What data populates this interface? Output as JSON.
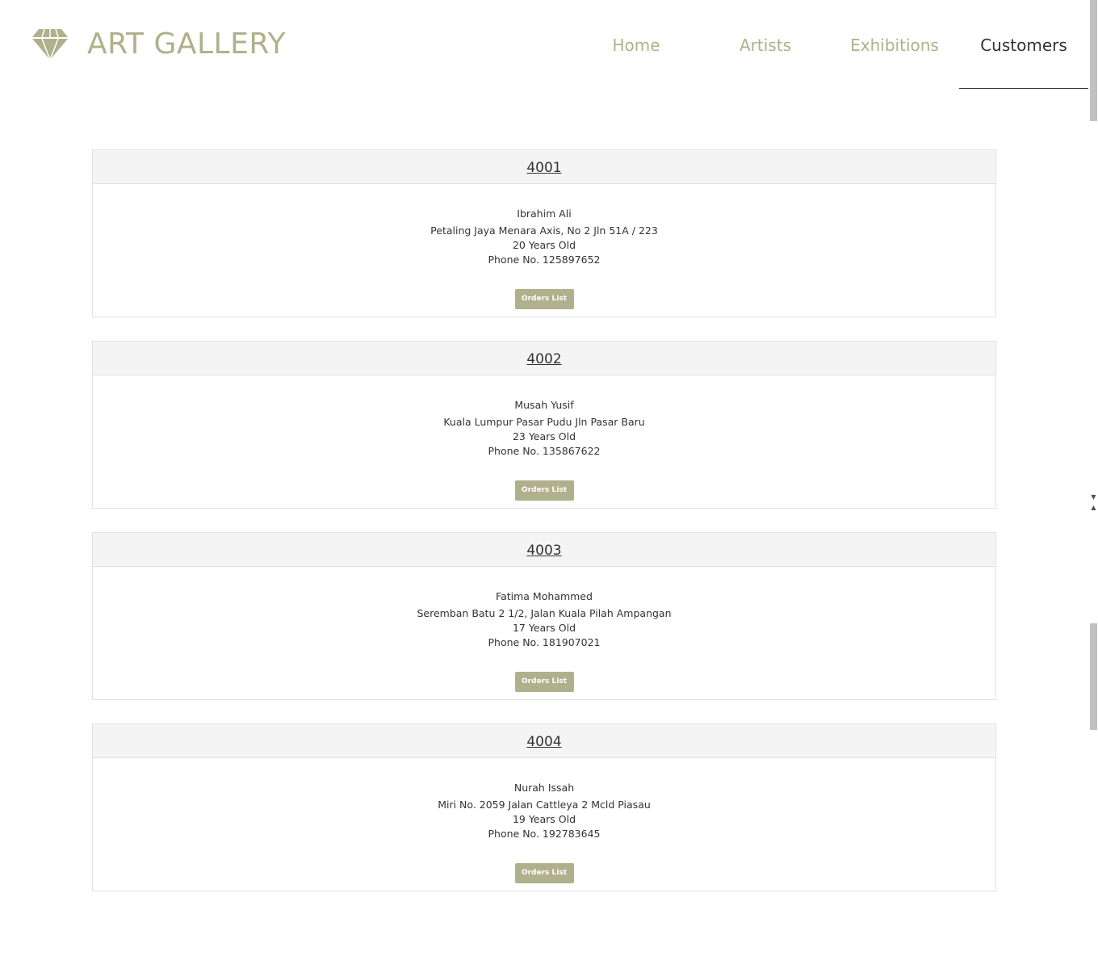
{
  "header": {
    "brand": "ART GALLERY",
    "logo_icon": "diamond-icon",
    "nav": [
      {
        "label": "Home",
        "active": false
      },
      {
        "label": "Artists",
        "active": false
      },
      {
        "label": "Exhibitions",
        "active": false
      },
      {
        "label": "Customers",
        "active": true
      }
    ]
  },
  "colors": {
    "accent": "#b0b08c",
    "text": "#333333",
    "card_header_bg": "#f4f4f4",
    "border": "#e2e2e2"
  },
  "customers": [
    {
      "id": "4001",
      "name": "Ibrahim Ali",
      "address": "Petaling Jaya Menara Axis, No 2 Jln 51A / 223",
      "age": "20 Years Old",
      "phone": "Phone No. 125897652",
      "button": "Orders List"
    },
    {
      "id": "4002",
      "name": "Musah Yusif",
      "address": "Kuala Lumpur Pasar Pudu Jln Pasar Baru",
      "age": "23 Years Old",
      "phone": "Phone No. 135867622",
      "button": "Orders List"
    },
    {
      "id": "4003",
      "name": "Fatima Mohammed",
      "address": "Seremban Batu 2 1/2, Jalan Kuala Pilah Ampangan",
      "age": "17 Years Old",
      "phone": "Phone No. 181907021",
      "button": "Orders List"
    },
    {
      "id": "4004",
      "name": "Nurah Issah",
      "address": "Miri No. 2059 Jalan Cattleya 2 Mcld Piasau",
      "age": "19 Years Old",
      "phone": "Phone No. 192783645",
      "button": "Orders List"
    }
  ]
}
